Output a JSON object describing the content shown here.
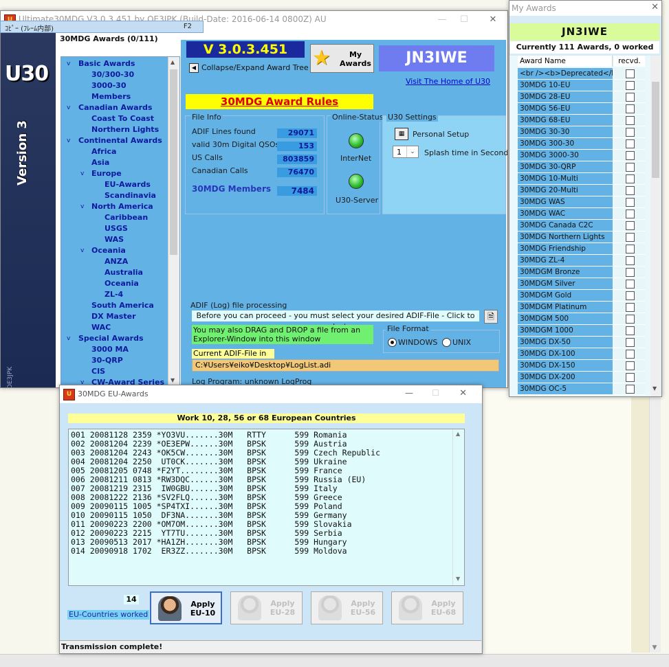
{
  "frame_label": "ｺﾋﾟｰ (ﾌﾚｰﾑ内部)",
  "frame_key": "F2",
  "main": {
    "title": "Ultimate30MDG V3.0.3.451 by OE3JPK (Build-Date: 2016-06-14 0800Z) AU",
    "logo_text": "U30",
    "logo_version": "Version 3",
    "logo_call": "OE3JPK",
    "tree_header": "30MDG Awards (0/111)",
    "tree": [
      {
        "label": "Basic Awards",
        "level": 0,
        "exp": "v"
      },
      {
        "label": "30/300-30",
        "level": 1
      },
      {
        "label": "3000-30",
        "level": 1
      },
      {
        "label": "Members",
        "level": 1
      },
      {
        "label": "Canadian Awards",
        "level": 0,
        "exp": "v"
      },
      {
        "label": "Coast To Coast",
        "level": 1
      },
      {
        "label": "Northern Lights",
        "level": 1
      },
      {
        "label": "Continental Awards",
        "level": 0,
        "exp": "v"
      },
      {
        "label": "Africa",
        "level": 1
      },
      {
        "label": "Asia",
        "level": 1
      },
      {
        "label": "Europe",
        "level": 1,
        "exp": "v"
      },
      {
        "label": "EU-Awards",
        "level": 2
      },
      {
        "label": "Scandinavia",
        "level": 2
      },
      {
        "label": "North America",
        "level": 1,
        "exp": "v"
      },
      {
        "label": "Caribbean",
        "level": 2
      },
      {
        "label": "USGS",
        "level": 2
      },
      {
        "label": "WAS",
        "level": 2
      },
      {
        "label": "Oceania",
        "level": 1,
        "exp": "v"
      },
      {
        "label": "ANZA",
        "level": 2
      },
      {
        "label": "Australia",
        "level": 2
      },
      {
        "label": "Oceania",
        "level": 2
      },
      {
        "label": "ZL-4",
        "level": 2
      },
      {
        "label": "South America",
        "level": 1
      },
      {
        "label": "DX Master",
        "level": 1
      },
      {
        "label": "WAC",
        "level": 1
      },
      {
        "label": "Special Awards",
        "level": 0,
        "exp": "v"
      },
      {
        "label": "3000 MA",
        "level": 1
      },
      {
        "label": "30-QRP",
        "level": 1
      },
      {
        "label": "CIS",
        "level": 1
      },
      {
        "label": "CW-Award Series",
        "level": 1,
        "exp": "v"
      }
    ],
    "version": "V 3.0.3.451",
    "collapse_label": "Collapse/Expand Award Tree",
    "my_awards_btn": "My Awards",
    "callsign": "JN3IWE",
    "home_link": "Visit The Home of U30",
    "rules_label": "30MDG Award Rules",
    "file_info": {
      "title": "File Info",
      "rows": [
        {
          "label": "ADIF Lines found",
          "value": "29071"
        },
        {
          "label": "valid 30m Digital QSOs",
          "value": "153"
        },
        {
          "label": "US Calls",
          "value": "803859"
        },
        {
          "label": "Canadian Calls",
          "value": "76470"
        }
      ],
      "members_label": "30MDG Members",
      "members_value": "7484"
    },
    "online_status": {
      "title": "Online-Status",
      "internet": "InterNet",
      "server": "U30-Server"
    },
    "settings": {
      "title": "U30 Settings",
      "personal": "Personal Setup",
      "splash_value": "1",
      "splash_label": "Splash time in Seconds"
    },
    "adif": {
      "title": "ADIF (Log) file processing",
      "select_msg": "Before you can proceed - you must select your desired ADIF-File - Click to select",
      "drag_msg": "You may also DRAG and DROP a file from an Explorer-Window into this window",
      "file_format_title": "File Format",
      "fmt_windows": "WINDOWS",
      "fmt_unix": "UNIX",
      "current_label": "Current ADIF-File in use:",
      "current_path": "C:¥Users¥eiko¥Desktop¥LogList.adi",
      "log_program": "Log Program: unknown LogProg"
    }
  },
  "my_awards": {
    "title": "My Awards",
    "callsign": "JN3IWE",
    "summary": "Currently 111 Awards, 0 worked",
    "col_name": "Award Name",
    "col_recvd": "recvd.",
    "items": [
      "<br /><b>Deprecated</b>...",
      "30MDG 10-EU",
      "30MDG 28-EU",
      "30MDG 56-EU",
      "30MDG 68-EU",
      "30MDG 30-30",
      "30MDG 300-30",
      "30MDG 3000-30",
      "30MDG 30-QRP",
      "30MDG 10-Multi",
      "30MDG 20-Multi",
      "30MDG WAS",
      "30MDG WAC",
      "30MDG Canada C2C",
      "30MDG Northern Lights",
      "30MDG Friendship",
      "30MDG ZL-4",
      "30MDGM Bronze",
      "30MDGM Silver",
      "30MDGM Gold",
      "30MDGM Platinum",
      "30MDGM 500",
      "30MDGM 1000",
      "30MDG DX-50",
      "30MDG DX-100",
      "30MDG DX-150",
      "30MDG DX-200",
      "30MDG OC-5"
    ]
  },
  "eu_awards": {
    "title": "30MDG EU-Awards",
    "header": "Work 10, 28, 56 or 68 European Countries",
    "log": [
      "001 20081128 2359 *YO3VU.......30M   RTTY      599 Romania",
      "002 20081204 2239 *OE3EPW......30M   BPSK      599 Austria",
      "003 20081204 2243 *OK5CW.......30M   BPSK      599 Czech Republic",
      "004 20081204 2250  UT0CK.......30M   BPSK      599 Ukraine",
      "005 20081205 0748 *F2YT........30M   BPSK      599 France",
      "006 20081211 0813 *RW3DQC......30M   BPSK      599 Russia (EU)",
      "007 20081219 2315  IW0GBU......30M   BPSK      599 Italy",
      "008 20081222 2136 *SV2FLQ......30M   BPSK      599 Greece",
      "009 20090115 1005 *SP4TXI......30M   BPSK      599 Poland",
      "010 20090115 1050  DF3NA.......30M   BPSK      599 Germany",
      "011 20090223 2200 *OM7OM.......30M   BPSK      599 Slovakia",
      "012 20090223 2215  YT7TU.......30M   BPSK      599 Serbia",
      "013 20090513 2017 *HA1ZH.......30M   BPSK      599 Hungary",
      "014 20090918 1702  ER3ZZ.......30M   BPSK      599 Moldova"
    ],
    "count": "14",
    "count_label": "EU-Countries worked",
    "buttons": [
      {
        "label": "Apply EU-10",
        "l1": "Apply",
        "l2": "EU-10",
        "enabled": true
      },
      {
        "label": "Apply EU-28",
        "l1": "Apply",
        "l2": "EU-28",
        "enabled": false
      },
      {
        "label": "Apply EU-56",
        "l1": "Apply",
        "l2": "EU-56",
        "enabled": false
      },
      {
        "label": "Apply EU-68",
        "l1": "Apply",
        "l2": "EU-68",
        "enabled": false
      }
    ],
    "status": "Transmission complete!"
  },
  "colors": {
    "accent_blue": "#63b2e6",
    "yellow": "#ffff00",
    "green_msg": "#70f070",
    "callsign_bg": "#6e7cf0",
    "rules_red": "#e00000"
  }
}
